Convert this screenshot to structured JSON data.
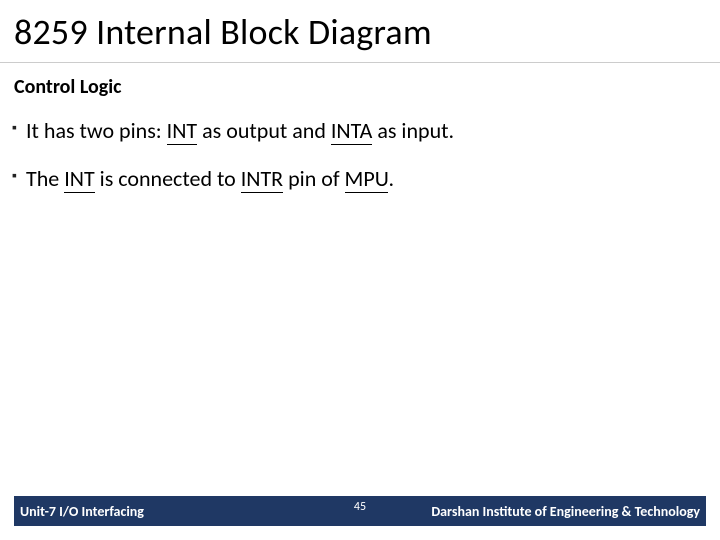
{
  "title": "8259 Internal Block Diagram",
  "subtitle": "Control Logic",
  "bullets": [
    {
      "pre": "It has two pins: ",
      "u1": "INT",
      "mid1": " as output and ",
      "u2": "INTA",
      "post": " as input."
    },
    {
      "pre": "The ",
      "u1": "INT",
      "mid1": " is connected to ",
      "u2": "INTR",
      "mid2": " pin of ",
      "u3": "MPU",
      "post": "."
    }
  ],
  "footer": {
    "left": "Unit-7 I/O Interfacing",
    "page": "45",
    "right": "Darshan Institute of Engineering & Technology"
  }
}
